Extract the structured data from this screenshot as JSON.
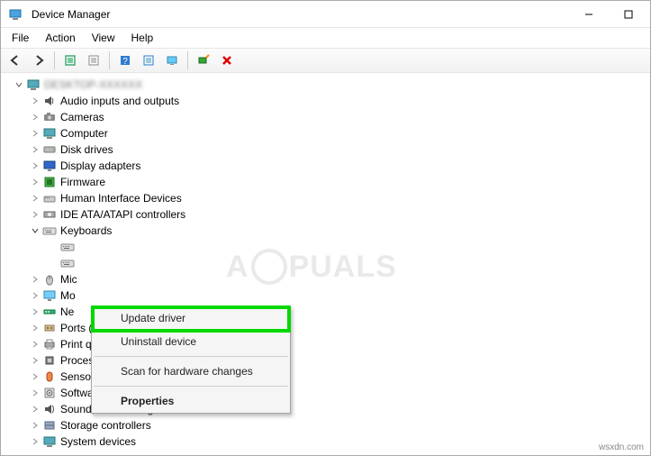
{
  "window": {
    "title": "Device Manager"
  },
  "menu": {
    "items": [
      "File",
      "Action",
      "View",
      "Help"
    ]
  },
  "toolbar_icons": [
    "back",
    "forward",
    "sep",
    "show-hidden",
    "properties",
    "sep",
    "help",
    "refresh",
    "monitor",
    "sep",
    "scan",
    "delete"
  ],
  "root": {
    "label": "DESKTOP-XXXXXX"
  },
  "categories": [
    {
      "icon": "audio",
      "label": "Audio inputs and outputs",
      "expandable": true
    },
    {
      "icon": "camera",
      "label": "Cameras",
      "expandable": true
    },
    {
      "icon": "computer",
      "label": "Computer",
      "expandable": true
    },
    {
      "icon": "disk",
      "label": "Disk drives",
      "expandable": true
    },
    {
      "icon": "display",
      "label": "Display adapters",
      "expandable": true
    },
    {
      "icon": "firmware",
      "label": "Firmware",
      "expandable": true
    },
    {
      "icon": "hid",
      "label": "Human Interface Devices",
      "expandable": true
    },
    {
      "icon": "ide",
      "label": "IDE ATA/ATAPI controllers",
      "expandable": true
    },
    {
      "icon": "keyboard",
      "label": "Keyboards",
      "expandable": true,
      "expanded": true
    },
    {
      "icon": "mouse",
      "label": "Mic",
      "truncated": true,
      "expandable": true
    },
    {
      "icon": "monitor",
      "label": "Mo",
      "truncated": true,
      "expandable": true
    },
    {
      "icon": "network",
      "label": "Ne",
      "truncated": true,
      "expandable": true
    },
    {
      "icon": "port",
      "label": "Ports (COM & LPT)",
      "expandable": true
    },
    {
      "icon": "printq",
      "label": "Print queues",
      "expandable": true
    },
    {
      "icon": "cpu",
      "label": "Processors",
      "expandable": true
    },
    {
      "icon": "sensor",
      "label": "Sensors",
      "expandable": true
    },
    {
      "icon": "software",
      "label": "Software devices",
      "expandable": true
    },
    {
      "icon": "sound",
      "label": "Sound, video and game controllers",
      "expandable": true
    },
    {
      "icon": "storage",
      "label": "Storage controllers",
      "expandable": true
    },
    {
      "icon": "system",
      "label": "System devices",
      "expandable": true,
      "cut": true
    }
  ],
  "context_menu": {
    "items": [
      {
        "label": "Update driver",
        "highlighted": true
      },
      {
        "label": "Uninstall device"
      },
      {
        "sep": true
      },
      {
        "label": "Scan for hardware changes"
      },
      {
        "sep": true
      },
      {
        "label": "Properties",
        "bold": true
      }
    ]
  },
  "watermark": {
    "prefix": "A",
    "suffix": "PUALS"
  },
  "footer": "wsxdn.com"
}
